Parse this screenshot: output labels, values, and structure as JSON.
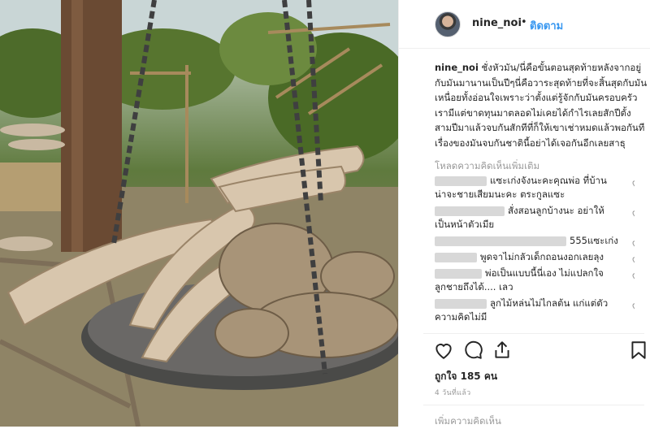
{
  "post": {
    "username": "nine_noi",
    "separator": "•",
    "follow_label": "ติดตาม",
    "caption_user": "nine_noi",
    "caption_text": " ชั่งหัวมัน/นี่คือขั้นตอนสุดท้ายหลังจากอยู่กับมันมานานเป็นปีๆนี่คือวาระสุดท้ายที่จะสิ้นสุดกับมันเหนื่อยทั้งอ่อนใจเพราะว่าตั้งแต่รู้จักกับมันครอบครัวเรามีแต่ขาดทุนมาตลอดไม่เคยได้กำไรเลยสักปีตั้งสามปีมาแล้วจบกันสักทีที่ก็ให้เขาเช่าหมดแล้วพอกันทีเรื่องของมันจบกันชาตินี้อย่าได้เจอกันอีกเลยสาธุ",
    "load_more": "โหลดความคิดเห็นเพิ่มเติม",
    "likes": "ถูกใจ 185 คน",
    "time": "4 วันที่แล้ว",
    "add_comment": "เพิ่มความคิดเห็น"
  },
  "comments": [
    {
      "text": "แซะเก่งจังนะคะคุณพ่อ ที่บ้านน่าจะชายเสียมนะคะ ตระกูลแซะ"
    },
    {
      "text": "สั่งสอนลูกบ้างนะ อย่าให้เป็นหน้าตัวเมีย"
    },
    {
      "text": "555แซะเก่ง"
    },
    {
      "text": "พูดจาไม่กลัวเด็กถอนงอกเลยลุง"
    },
    {
      "text": "พ่อเป็นแบบนี้นี่เอง ไม่แปลกใจลูกชายถึงได้.... เลว"
    },
    {
      "text": "ลูกไม้หล่นไม่ไกลต้น แก่แต่ตัวความคิดไม่มี"
    }
  ],
  "icons": {
    "avatar": "profile-avatar",
    "heart": "heart-icon",
    "comment": "comment-icon",
    "share": "share-icon",
    "bookmark": "bookmark-icon"
  },
  "colors": {
    "accent": "#3897f0",
    "text": "#262626",
    "muted": "#999999"
  }
}
